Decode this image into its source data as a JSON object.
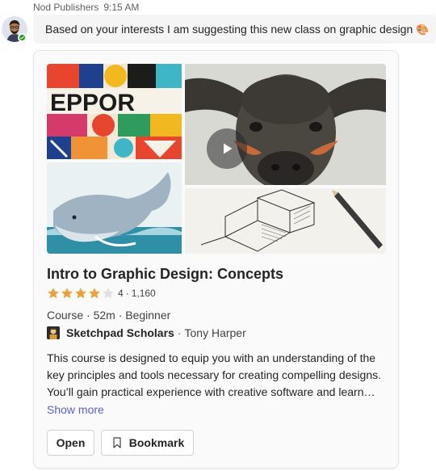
{
  "message": {
    "sender": "Nod Publishers",
    "time": "9:15 AM",
    "text": "Based on your interests I am suggesting this new class on graphic design",
    "emoji": "🎨"
  },
  "card": {
    "title": "Intro to Graphic Design: Concepts",
    "rating": {
      "value": "4",
      "stars": 4,
      "max_stars": 5,
      "count": "1,160"
    },
    "info": "Course · 52m · Beginner",
    "provider": "Sketchpad Scholars",
    "author": "Tony Harper",
    "description_lines": [
      "This course is designed to equip you with an understanding of the",
      "key principles and tools necessary for creating compelling designs.",
      "You’ll gain practical experience with creative software and learn…"
    ],
    "show_more": "Show more",
    "buttons": {
      "open": "Open",
      "bookmark": "Bookmark"
    },
    "images": [
      "colorful-typography-art",
      "water-buffalo-photo",
      "whale-illustration",
      "pencil-sketch-cubes"
    ],
    "play_icon": "play-icon"
  },
  "colors": {
    "accent": "#5b5fc7",
    "star": "#e8a33b",
    "presence": "#13a10e"
  },
  "icons": {
    "presence": "presence-available-icon",
    "bookmark": "bookmark-icon",
    "star": "star-icon"
  }
}
